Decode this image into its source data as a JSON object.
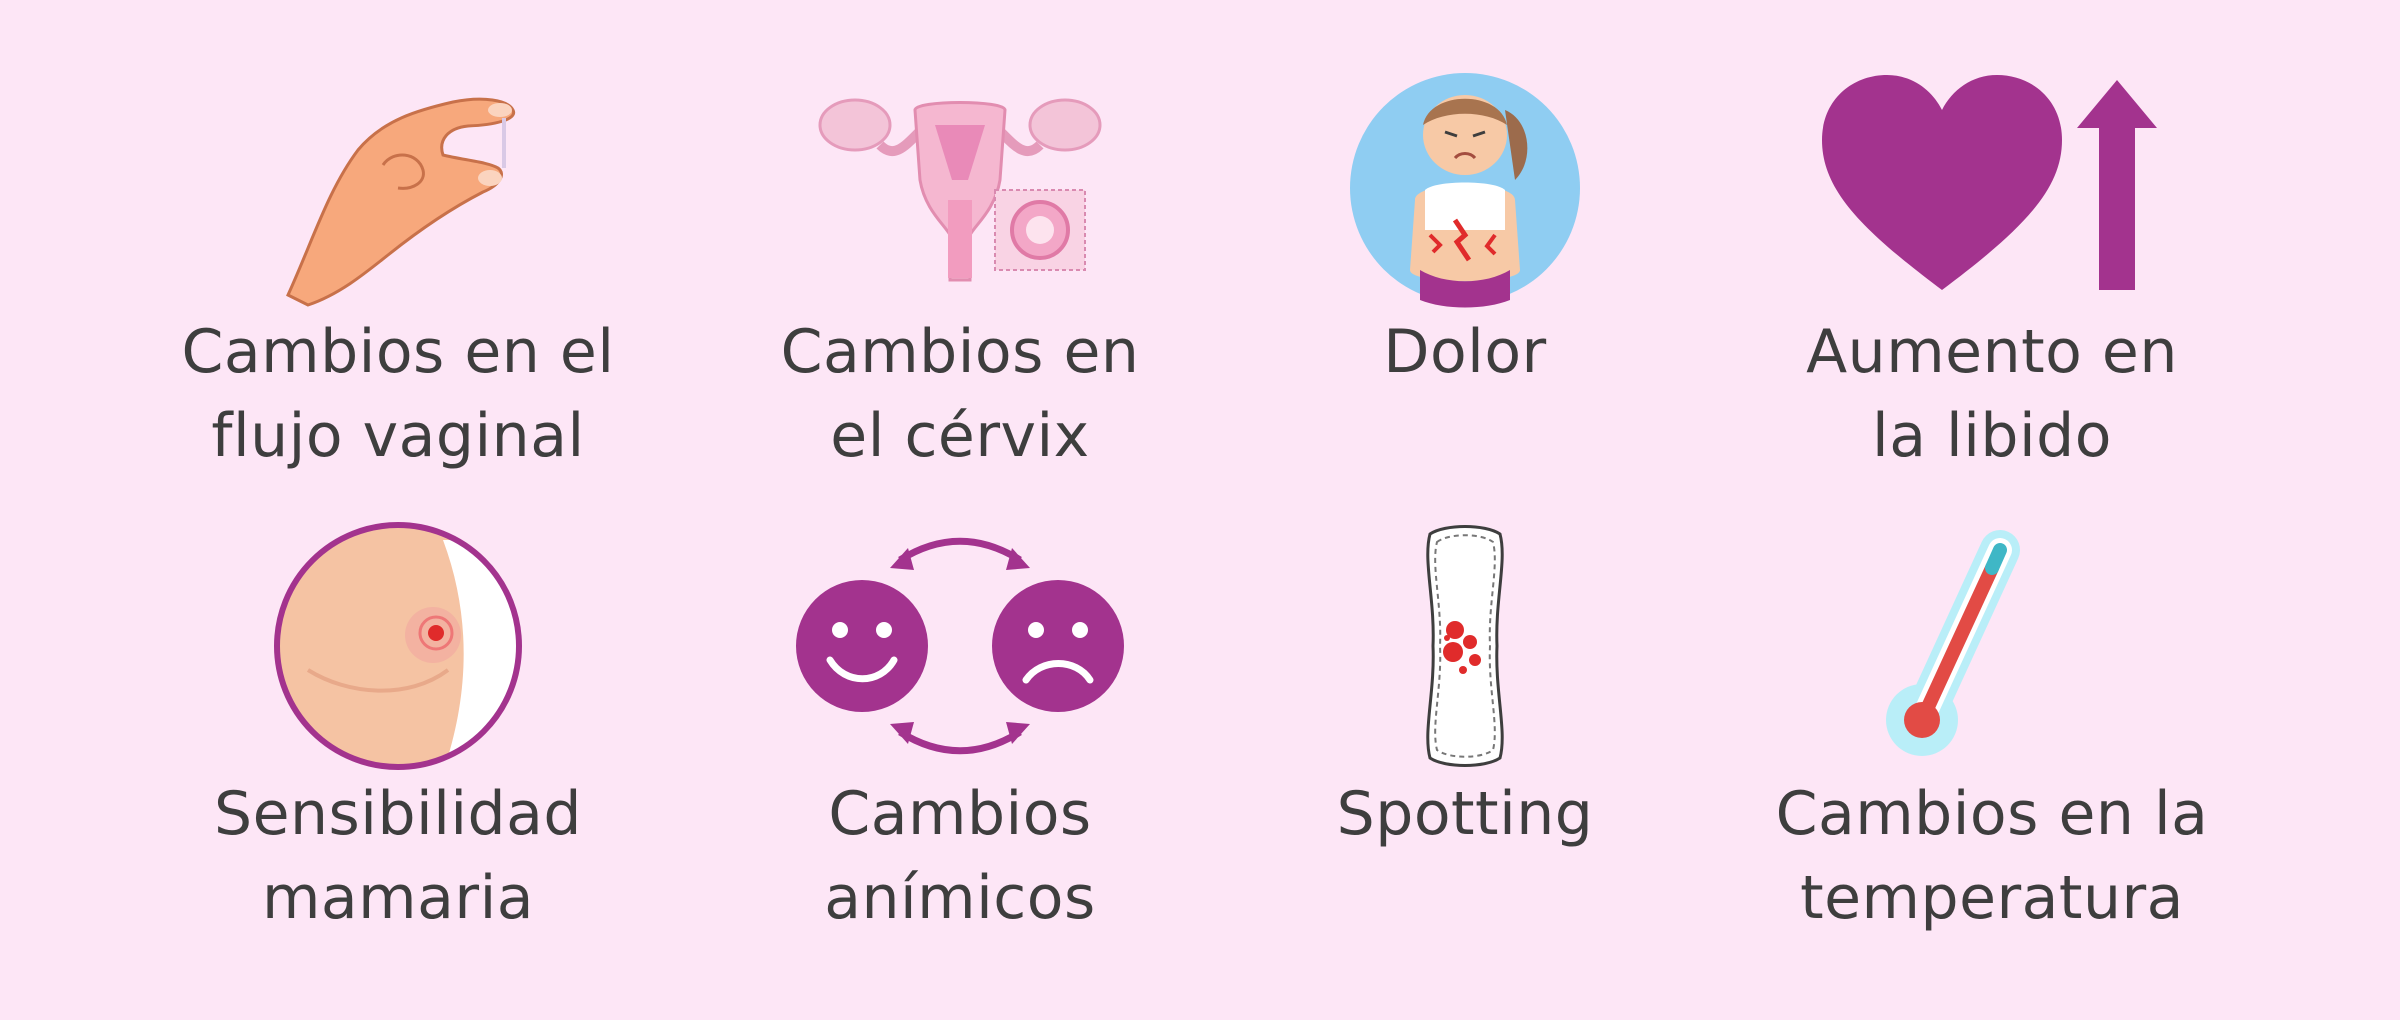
{
  "colors": {
    "background": "#fde6f6",
    "accent": "#a3338e",
    "text": "#3e3e3e"
  },
  "items": [
    {
      "icon": "hand-pinch-icon",
      "line1": "Cambios en el",
      "line2": "flujo vaginal"
    },
    {
      "icon": "uterus-icon",
      "line1": "Cambios en",
      "line2": "el cérvix"
    },
    {
      "icon": "woman-pain-icon",
      "line1": "Dolor",
      "line2": ""
    },
    {
      "icon": "heart-up-arrow-icon",
      "line1": "Aumento en",
      "line2": "la libido"
    },
    {
      "icon": "breast-icon",
      "line1": "Sensibilidad",
      "line2": "mamaria"
    },
    {
      "icon": "mood-faces-icon",
      "line1": "Cambios",
      "line2": "anímicos"
    },
    {
      "icon": "panty-liner-icon",
      "line1": "Spotting",
      "line2": ""
    },
    {
      "icon": "thermometer-icon",
      "line1": "Cambios en la",
      "line2": "temperatura"
    }
  ]
}
